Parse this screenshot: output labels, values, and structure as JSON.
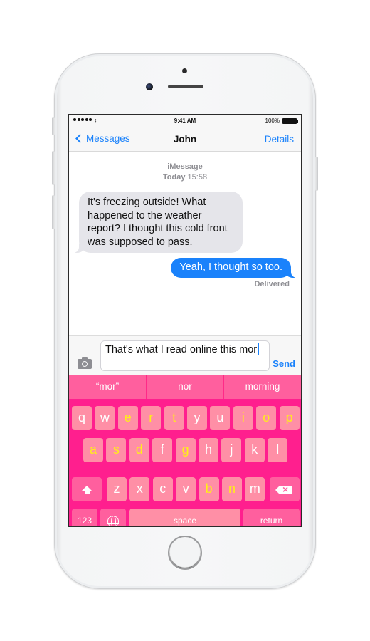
{
  "status_bar": {
    "signal_dots": 5,
    "wifi_icon": "wifi-icon",
    "time": "9:41 AM",
    "battery_percent": "100%",
    "battery_icon": "battery-icon"
  },
  "nav": {
    "back_label": "Messages",
    "back_icon": "chevron-left-icon",
    "title": "John",
    "details_label": "Details"
  },
  "conversation": {
    "service": "iMessage",
    "date_day": "Today",
    "date_time": "15:58",
    "messages": [
      {
        "direction": "incoming",
        "text": "It's freezing outside! What happened to the weather report? I thought this cold front was supposed to pass."
      },
      {
        "direction": "outgoing",
        "text": "Yeah, I thought so too."
      }
    ],
    "delivery_status": "Delivered"
  },
  "composer": {
    "camera_icon": "camera-icon",
    "text_value": "That's what I read online this mor",
    "send_label": "Send"
  },
  "keyboard": {
    "suggestions": [
      "“mor”",
      "nor",
      "morning"
    ],
    "rows": [
      [
        "q",
        "w",
        "e",
        "r",
        "t",
        "y",
        "u",
        "i",
        "o",
        "p"
      ],
      [
        "a",
        "s",
        "d",
        "f",
        "g",
        "h",
        "j",
        "k",
        "l"
      ],
      [
        "z",
        "x",
        "c",
        "v",
        "b",
        "n",
        "m"
      ]
    ],
    "highlighted_keys": [
      "e",
      "r",
      "t",
      "i",
      "o",
      "p",
      "a",
      "s",
      "d",
      "g",
      "b",
      "n"
    ],
    "shift_icon": "shift-icon",
    "delete_icon": "delete-icon",
    "numbers_label": "123",
    "globe_icon": "globe-icon",
    "space_label": "space",
    "return_label": "return",
    "colors": {
      "background": "#ff1f8e",
      "key": "#ff8fa6",
      "function_key": "#ff5f9e",
      "key_text": "#ffffff",
      "highlight_text": "#ffee1a"
    }
  },
  "colors": {
    "accent": "#1a82fb",
    "incoming_bubble": "#e5e5ea",
    "outgoing_bubble": "#1a82fb",
    "meta_text": "#8e8e93"
  }
}
